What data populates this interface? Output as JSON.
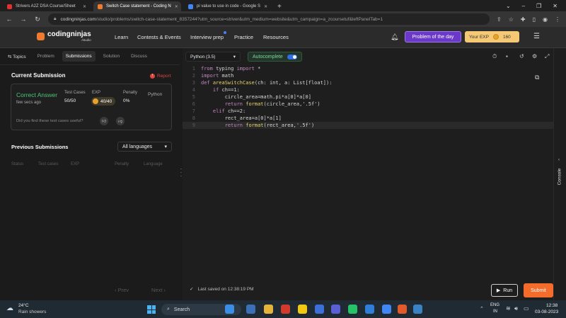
{
  "browser": {
    "tabs": [
      {
        "title": "Strivers A2Z DSA Course/Sheet",
        "color": "#e0312e",
        "active": false
      },
      {
        "title": "Switch Case statement - Coding N",
        "color": "#f07b2e",
        "active": true
      },
      {
        "title": "pi value to use in code - Google S",
        "color": "#4285f4",
        "active": false
      }
    ],
    "new_tab": "+",
    "window_controls": [
      "⌄",
      "–",
      "❐",
      "✕"
    ],
    "url_host": "codingninjas.com",
    "url_path": "/studio/problems/switch-case-statement_8357244?utm_source=striver&utm_medium=website&utm_campaign=a_zcoursetuf&leftPanelTab=1"
  },
  "site": {
    "logo_name": "codingninjas",
    "logo_sub": "/studio",
    "nav": [
      "Learn",
      "Contests & Events",
      "Interview prep",
      "Practice",
      "Resources"
    ],
    "problem_of_day": "Problem of the day",
    "exp_label": "Your EXP",
    "exp_value": "160"
  },
  "left": {
    "tabs": [
      "Topics",
      "Problem",
      "Submissions",
      "Solution",
      "Discuss"
    ],
    "active_tab": "Submissions",
    "current_title": "Current Submission",
    "report": "Report",
    "status": "Correct Answer",
    "time_ago": "few secs ago",
    "test_cases_label": "Test Cases",
    "test_cases_value": "50/50",
    "exp_label": "EXP",
    "exp_value": "40/40",
    "penalty_label": "Penalty",
    "penalty_value": "0%",
    "language": "Python",
    "feedback": "Did you find these test cases useful?",
    "previous_title": "Previous Submissions",
    "language_filter": "All languages",
    "columns": [
      "Status",
      "Test cases",
      "EXP",
      "Penalty",
      "Language"
    ],
    "prev": "‹ Prev",
    "next": "Next ›"
  },
  "editor": {
    "language": "Python (3.5)",
    "autocomplete": "Autocomplete",
    "autocomplete_on": true,
    "code": [
      [
        {
          "t": "from ",
          "c": "kw"
        },
        {
          "t": "typing ",
          "c": "tx"
        },
        {
          "t": "import ",
          "c": "kw"
        },
        {
          "t": "*",
          "c": "tx"
        }
      ],
      [
        {
          "t": "import ",
          "c": "kw"
        },
        {
          "t": "math",
          "c": "tx"
        }
      ],
      [
        {
          "t": "def ",
          "c": "kw"
        },
        {
          "t": "areaSwitchCase",
          "c": "fn"
        },
        {
          "t": "(ch: int, a: List[float]):",
          "c": "tx"
        }
      ],
      [
        {
          "t": "    ",
          "c": "tx"
        },
        {
          "t": "if ",
          "c": "kw"
        },
        {
          "t": "ch==1:",
          "c": "tx"
        }
      ],
      [
        {
          "t": "        circle_area=math.pi*a[0]*a[0]",
          "c": "tx"
        }
      ],
      [
        {
          "t": "        ",
          "c": "tx"
        },
        {
          "t": "return ",
          "c": "kw"
        },
        {
          "t": "format",
          "c": "fn"
        },
        {
          "t": "(circle_area,'.5f')",
          "c": "tx"
        }
      ],
      [
        {
          "t": "    ",
          "c": "tx"
        },
        {
          "t": "elif ",
          "c": "kw"
        },
        {
          "t": "ch==2:",
          "c": "tx"
        }
      ],
      [
        {
          "t": "        rect_area=a[0]*a[1]",
          "c": "tx"
        }
      ],
      [
        {
          "t": "        ",
          "c": "tx"
        },
        {
          "t": "return ",
          "c": "kw"
        },
        {
          "t": "format",
          "c": "fn"
        },
        {
          "t": "(rect_area,'.5f')",
          "c": "tx"
        }
      ]
    ],
    "highlight_line": 9,
    "last_saved": "Last saved on 12:38:19 PM",
    "run": "Run",
    "submit": "Submit",
    "console": "Console"
  },
  "taskbar": {
    "weather_temp": "24°C",
    "weather_desc": "Rain showers",
    "search": "Search",
    "lang_top": "ENG",
    "lang_bottom": "IN",
    "time": "12:38",
    "date": "03-08-2023",
    "apps": [
      "#3a8ee6",
      "#3b6fb6",
      "#e3b33a",
      "#d33a2c",
      "#f2c811",
      "#3c6fd8",
      "#5a5fd6",
      "#25c266",
      "#2f7fd9",
      "#4285f4",
      "#e25a2b",
      "#3b82c4"
    ]
  }
}
